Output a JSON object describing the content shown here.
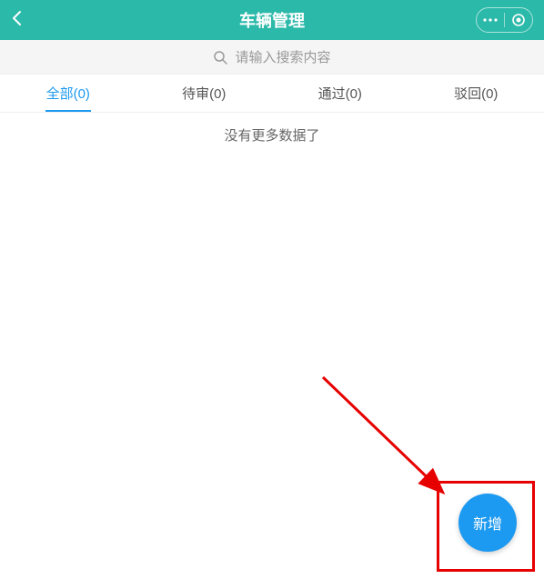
{
  "header": {
    "title": "车辆管理"
  },
  "search": {
    "placeholder": "请输入搜索内容"
  },
  "tabs": [
    {
      "label": "全部(0)",
      "active": true
    },
    {
      "label": "待审(0)",
      "active": false
    },
    {
      "label": "通过(0)",
      "active": false
    },
    {
      "label": "驳回(0)",
      "active": false
    }
  ],
  "content": {
    "empty_text": "没有更多数据了"
  },
  "fab": {
    "label": "新增"
  }
}
